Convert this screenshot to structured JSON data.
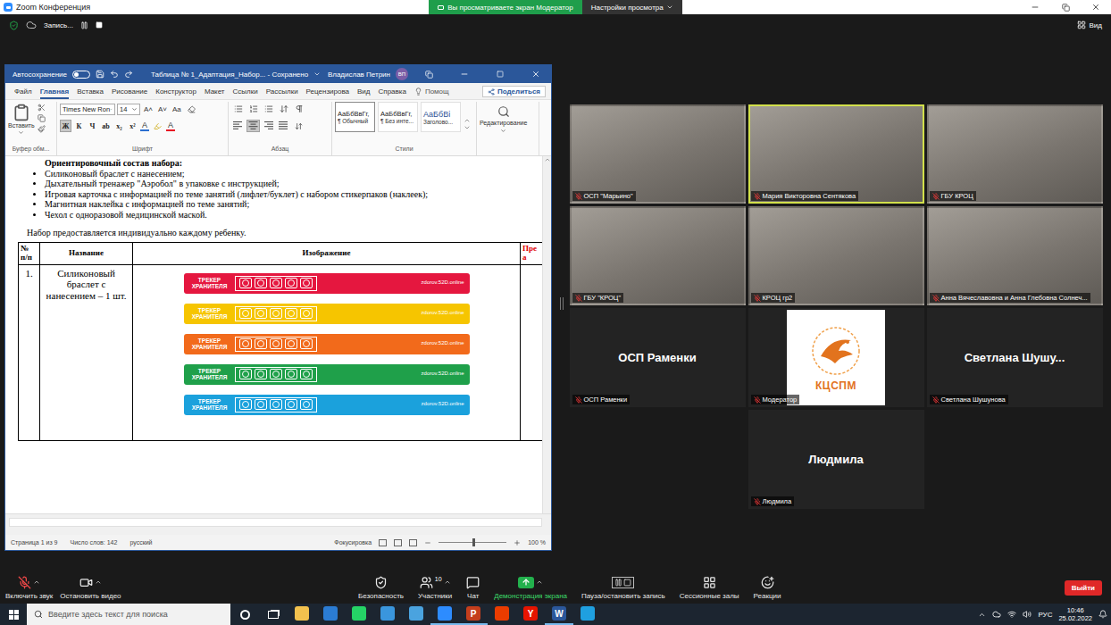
{
  "zoom": {
    "title": "Zoom Конференция",
    "banner": "Вы просматриваете экран Модератор",
    "view_settings": "Настройки просмотра",
    "recording": "Запись...",
    "view": "Вид"
  },
  "word": {
    "autosave": {
      "label": "Автосохранение",
      "on": false
    },
    "doc_title": "Таблица № 1_Адаптация_Набор... - Сохранено",
    "user": "Владислав Петрин",
    "initials": "ВП",
    "tabs": [
      {
        "label": "Файл",
        "selected": false
      },
      {
        "label": "Главная",
        "selected": true
      },
      {
        "label": "Вставка",
        "selected": false
      },
      {
        "label": "Рисование",
        "selected": false
      },
      {
        "label": "Конструктор",
        "selected": false
      },
      {
        "label": "Макет",
        "selected": false
      },
      {
        "label": "Ссылки",
        "selected": false
      },
      {
        "label": "Рассылки",
        "selected": false
      },
      {
        "label": "Рецензирова",
        "selected": false
      },
      {
        "label": "Вид",
        "selected": false
      },
      {
        "label": "Справка",
        "selected": false
      }
    ],
    "tell_me": "Помощ",
    "share": "Поделиться",
    "ribbon": {
      "paste": "Вставить",
      "clipboard_group": "Буфер обм...",
      "font": "Times New Ron",
      "size": "14",
      "font_tools": [
        "A˄",
        "A˅",
        "Aa"
      ],
      "format_buttons": [
        {
          "label": "Ж",
          "selected": true
        },
        {
          "label": "К",
          "selected": false
        },
        {
          "label": "Ч",
          "selected": false
        },
        {
          "label": "ab",
          "selected": false
        },
        {
          "label": "x₂",
          "selected": false
        },
        {
          "label": "x²",
          "selected": false
        }
      ],
      "font_colors": [
        {
          "label": "A",
          "color": "#2b6fd0"
        },
        {
          "label": "A",
          "color": "#e81123"
        }
      ],
      "font_group": "Шрифт",
      "align_buttons": [
        {
          "selected": false
        },
        {
          "selected": true
        },
        {
          "selected": false
        },
        {
          "selected": false
        }
      ],
      "paragraph_group": "Абзац",
      "styles": [
        {
          "sample": "АаБбВвГг,",
          "name": "¶ Обычный",
          "selected": true
        },
        {
          "sample": "АаБбВвГг,",
          "name": "¶ Без инте...",
          "selected": false
        },
        {
          "sample": "АаБбВі",
          "name": "Заголово...",
          "selected": false
        }
      ],
      "styles_group": "Стили",
      "editing": "Редактирование"
    },
    "document": {
      "heading": "Ориентировочный состав набора:",
      "bullets": [
        "Силиконовый браслет с нанесением;",
        "Дыхательный тренажер \"Аэробол\" в упаковке с инструкцией;",
        "Игровая карточка с информацией по теме занятий (лифлет/буклет) с набором стикерпаков (наклеек);",
        "Магнитная наклейка с информацией по теме занятий;",
        "Чехол с одноразовой медицинской маской."
      ],
      "note": "Набор предоставляется индивидуально каждому ребенку.",
      "table": {
        "columns": [
          {
            "lines": [
              "№",
              "п/п"
            ],
            "color": "#000000"
          },
          {
            "lines": [
              "Название"
            ],
            "color": "#000000"
          },
          {
            "lines": [
              "Изображение"
            ],
            "color": "#000000"
          },
          {
            "lines": [
              "Пре",
              "а"
            ],
            "color": "#e00000"
          }
        ],
        "rows": [
          {
            "number": "1.",
            "name": "Силиконовый браслет с нанесением – 1 шт.",
            "bracelets": [
              {
                "color": "#e5173f",
                "label": "ТРЕКЕР ХРАНИТЕЛЯ",
                "url": "zdorov.52D.online"
              },
              {
                "color": "#f6c500",
                "label": "ТРЕКЕР ХРАНИТЕЛЯ",
                "url": "zdorov.52D.online"
              },
              {
                "color": "#f26a1b",
                "label": "ТРЕКЕР ХРАНИТЕЛЯ",
                "url": "zdorov.52D.online"
              },
              {
                "color": "#1fa04a",
                "label": "ТРЕКЕР ХРАНИТЕЛЯ",
                "url": "zdorov.52D.online"
              },
              {
                "color": "#1ba1dc",
                "label": "ТРЕКЕР ХРАНИТЕЛЯ",
                "url": "zdorov.52D.online"
              }
            ]
          }
        ]
      }
    },
    "status_bar": {
      "items": [
        "Страница 1 из 9",
        "Число слов: 142",
        "русский"
      ],
      "focus": "Фокусировка",
      "zoom": "100 %",
      "zoom_level": 0.5
    }
  },
  "participants": [
    {
      "name": "ОСП \"Марьино\"",
      "kind": "video",
      "muted": true,
      "speaking": false
    },
    {
      "name": "Мария Викторовна Сентякова",
      "kind": "video",
      "muted": true,
      "speaking": true
    },
    {
      "name": "ГБУ КРОЦ",
      "kind": "video",
      "muted": true,
      "speaking": false
    },
    {
      "name": "ГБУ \"КРОЦ\"",
      "kind": "video",
      "muted": true,
      "speaking": false
    },
    {
      "name": "КРОЦ гр2",
      "kind": "video",
      "muted": true,
      "speaking": false
    },
    {
      "name": "Анна Вячеславовна и Анна Глебовна Солнеч...",
      "kind": "video",
      "muted": true,
      "speaking": false
    },
    {
      "name": "ОСП Раменки",
      "kind": "name",
      "display": "ОСП Раменки",
      "muted": true,
      "speaking": false
    },
    {
      "name": "Модератор",
      "kind": "logo",
      "logo_text": "КЦСПМ",
      "muted": true,
      "speaking": false
    },
    {
      "name": "Светлана Шушунова",
      "kind": "name",
      "display": "Светлана Шушу...",
      "muted": true,
      "speaking": false
    },
    {
      "name": "Людмила",
      "kind": "name",
      "display": "Людмила",
      "muted": true,
      "speaking": false
    }
  ],
  "toolbar": {
    "left": [
      {
        "label": "Включить звук",
        "kind": "mic",
        "menu": true,
        "active": false
      },
      {
        "label": "Остановить видео",
        "kind": "video",
        "menu": true,
        "active": false
      }
    ],
    "center": [
      {
        "label": "Безопасность",
        "kind": "security",
        "menu": false,
        "active": false
      },
      {
        "label": "Участники",
        "kind": "participants",
        "count": "10",
        "menu": true,
        "active": false
      },
      {
        "label": "Чат",
        "kind": "chat",
        "menu": false,
        "active": false
      },
      {
        "label": "Демонстрация экрана",
        "kind": "share",
        "menu": true,
        "active": true
      },
      {
        "label": "Пауза/остановить запись",
        "kind": "record",
        "menu": false,
        "active": false
      },
      {
        "label": "Сессионные залы",
        "kind": "rooms",
        "menu": false,
        "active": false
      },
      {
        "label": "Реакции",
        "kind": "reactions",
        "menu": false,
        "active": false
      }
    ],
    "leave": "Выйти"
  },
  "taskbar": {
    "search": "Введите здесь текст для поиска",
    "apps": [
      {
        "color": "#f2c14e",
        "glyph": "",
        "open": false
      },
      {
        "color": "#2b7cd3",
        "glyph": "",
        "open": false
      },
      {
        "color": "#25d366",
        "glyph": "",
        "open": false
      },
      {
        "color": "#3a96dd",
        "glyph": "",
        "open": false
      },
      {
        "color": "#4aa3df",
        "glyph": "",
        "open": false
      },
      {
        "color": "#2d8cff",
        "glyph": "",
        "open": true
      },
      {
        "color": "#c43e1c",
        "glyph": "P",
        "open": true
      },
      {
        "color": "#eb3c00",
        "glyph": "",
        "open": false
      },
      {
        "color": "#e61400",
        "glyph": "Y",
        "open": false
      },
      {
        "color": "#2b579a",
        "glyph": "W",
        "open": true
      },
      {
        "color": "#1fa0e0",
        "glyph": "",
        "open": false
      }
    ],
    "lang": "РУС",
    "time": "10:46",
    "date": "25.02.2022"
  }
}
